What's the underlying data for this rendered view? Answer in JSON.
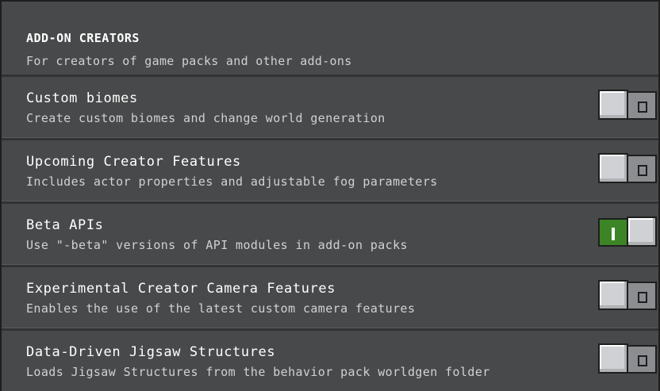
{
  "section": {
    "title": "ADD-ON CREATORS",
    "subtitle": "For creators of game packs and other add-ons"
  },
  "toggles": [
    {
      "title": "Custom biomes",
      "description": "Create custom biomes and change world generation",
      "enabled": false
    },
    {
      "title": "Upcoming Creator Features",
      "description": "Includes actor properties and adjustable fog parameters",
      "enabled": false
    },
    {
      "title": "Beta APIs",
      "description": "Use \"-beta\" versions of API modules in add-on packs",
      "enabled": true
    },
    {
      "title": "Experimental Creator Camera Features",
      "description": "Enables the use of the latest custom camera features",
      "enabled": false
    },
    {
      "title": "Data-Driven Jigsaw Structures",
      "description": "Loads Jigsaw Structures from the behavior pack worldgen folder",
      "enabled": false
    }
  ],
  "colors": {
    "panel": "#48494a",
    "separator": "#313233",
    "toggle_on": "#3c8527",
    "toggle_off": "#8c8d90",
    "knob": "#d0d1d4"
  }
}
